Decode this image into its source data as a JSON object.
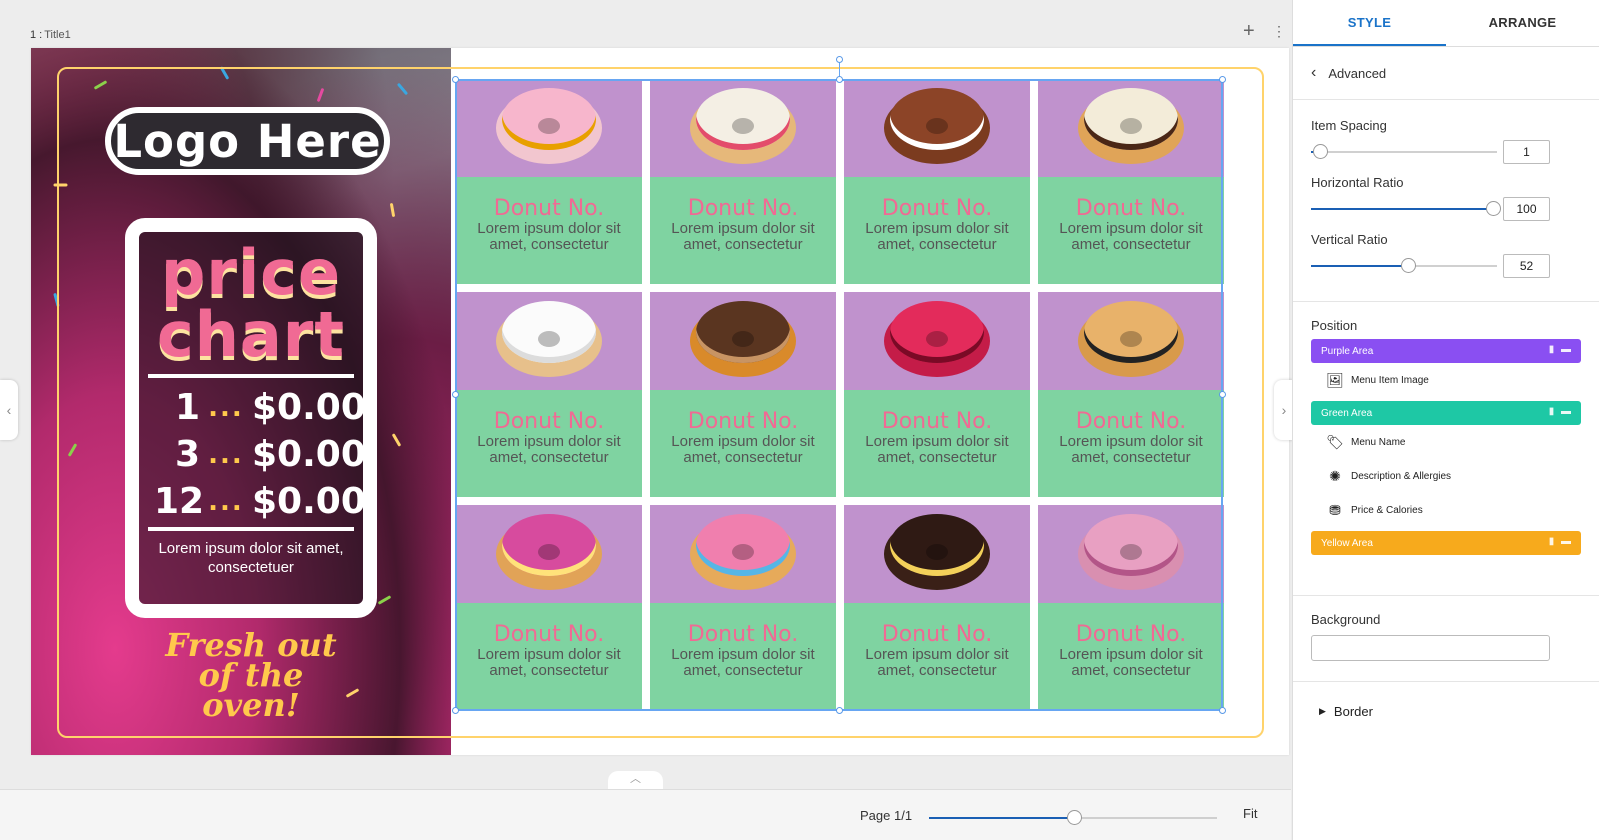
{
  "stage": {
    "page_label_num": "1 :",
    "page_label_title": "Title1",
    "add_icon": "plus-icon",
    "more_icon": "more-vertical-icon"
  },
  "poster": {
    "logo_text": "Logo Here",
    "price_title": "price chart",
    "price_rows": [
      {
        "qty": "1",
        "dots": "...",
        "amount": "$0.00"
      },
      {
        "qty": "3",
        "dots": "...",
        "amount": "$0.00"
      },
      {
        "qty": "12",
        "dots": "...",
        "amount": "$0.00"
      }
    ],
    "price_footer": "Lorem ipsum dolor sit amet, consectetuer",
    "tagline": "Fresh out of the oven!",
    "colors": {
      "pink": "#f06a94",
      "yellow": "#ffc94c",
      "purple_area": "#c092cd",
      "green_area": "#7fd3a1"
    }
  },
  "menu_items": [
    {
      "name": "Donut No.",
      "desc": "Lorem ipsum dolor sit amet, consectetur",
      "donut": {
        "dough": "#f2c6cf",
        "topping": "#f7b6cc",
        "accent": "#e8a000"
      }
    },
    {
      "name": "Donut No.",
      "desc": "Lorem ipsum dolor sit amet, consectetur",
      "donut": {
        "dough": "#e6b87a",
        "topping": "#f4efe4",
        "accent": "#e34c6b"
      }
    },
    {
      "name": "Donut No.",
      "desc": "Lorem ipsum dolor sit amet, consectetur",
      "donut": {
        "dough": "#7b3b1f",
        "topping": "#8c4427",
        "accent": "#ffffff"
      }
    },
    {
      "name": "Donut No.",
      "desc": "Lorem ipsum dolor sit amet, consectetur",
      "donut": {
        "dough": "#e0a458",
        "topping": "#f3ecd9",
        "accent": "#4a2716"
      }
    },
    {
      "name": "Donut No.",
      "desc": "Lorem ipsum dolor sit amet, consectetur",
      "donut": {
        "dough": "#e7c08b",
        "topping": "#fbfbfb",
        "accent": "#dcdcdc"
      }
    },
    {
      "name": "Donut No.",
      "desc": "Lorem ipsum dolor sit amet, consectetur",
      "donut": {
        "dough": "#d98a2a",
        "topping": "#5a3520",
        "accent": "#c89463"
      }
    },
    {
      "name": "Donut No.",
      "desc": "Lorem ipsum dolor sit amet, consectetur",
      "donut": {
        "dough": "#c41c48",
        "topping": "#e32b5b",
        "accent": "#7a0a26"
      }
    },
    {
      "name": "Donut No.",
      "desc": "Lorem ipsum dolor sit amet, consectetur",
      "donut": {
        "dough": "#d89a4b",
        "topping": "#e8b26a",
        "accent": "#222222"
      }
    },
    {
      "name": "Donut No.",
      "desc": "Lorem ipsum dolor sit amet, consectetur",
      "donut": {
        "dough": "#e1a357",
        "topping": "#d74b9e",
        "accent": "#ffe27a"
      }
    },
    {
      "name": "Donut No.",
      "desc": "Lorem ipsum dolor sit amet, consectetur",
      "donut": {
        "dough": "#e6aa5a",
        "topping": "#f07fae",
        "accent": "#55b6e6"
      }
    },
    {
      "name": "Donut No.",
      "desc": "Lorem ipsum dolor sit amet, consectetur",
      "donut": {
        "dough": "#3a2017",
        "topping": "#2f1a14",
        "accent": "#f4d15a"
      }
    },
    {
      "name": "Donut No.",
      "desc": "Lorem ipsum dolor sit amet, consectetur",
      "donut": {
        "dough": "#d98fb0",
        "topping": "#e8a0c2",
        "accent": "#b35588"
      }
    }
  ],
  "footer_bar": {
    "page_indicator": "Page 1/1",
    "zoom_fraction": 0.505,
    "fit_label": "Fit"
  },
  "panel": {
    "tabs": [
      "STYLE",
      "ARRANGE"
    ],
    "active_tab": "STYLE",
    "back_label": "Advanced",
    "sliders": [
      {
        "label": "Item Spacing",
        "value": "1",
        "fraction": 0.05
      },
      {
        "label": "Horizontal Ratio",
        "value": "100",
        "fraction": 0.98
      },
      {
        "label": "Vertical Ratio",
        "value": "52",
        "fraction": 0.52
      }
    ],
    "position_label": "Position",
    "purple_area": {
      "label": "Purple Area",
      "color": "#8a4ff2"
    },
    "purple_children": [
      {
        "label": "Menu Item Image",
        "icon": "image-icon"
      }
    ],
    "green_area": {
      "label": "Green Area",
      "color": "#1ec8a5"
    },
    "green_children": [
      {
        "label": "Menu Name",
        "icon": "tag-icon"
      },
      {
        "label": "Description & Allergies",
        "icon": "sparkle-icon"
      },
      {
        "label": "Price & Calories",
        "icon": "coins-icon"
      }
    ],
    "yellow_area": {
      "label": "Yellow Area",
      "color": "#f7aa1c"
    },
    "background_label": "Background",
    "background_value": "",
    "border_label": "Border"
  }
}
